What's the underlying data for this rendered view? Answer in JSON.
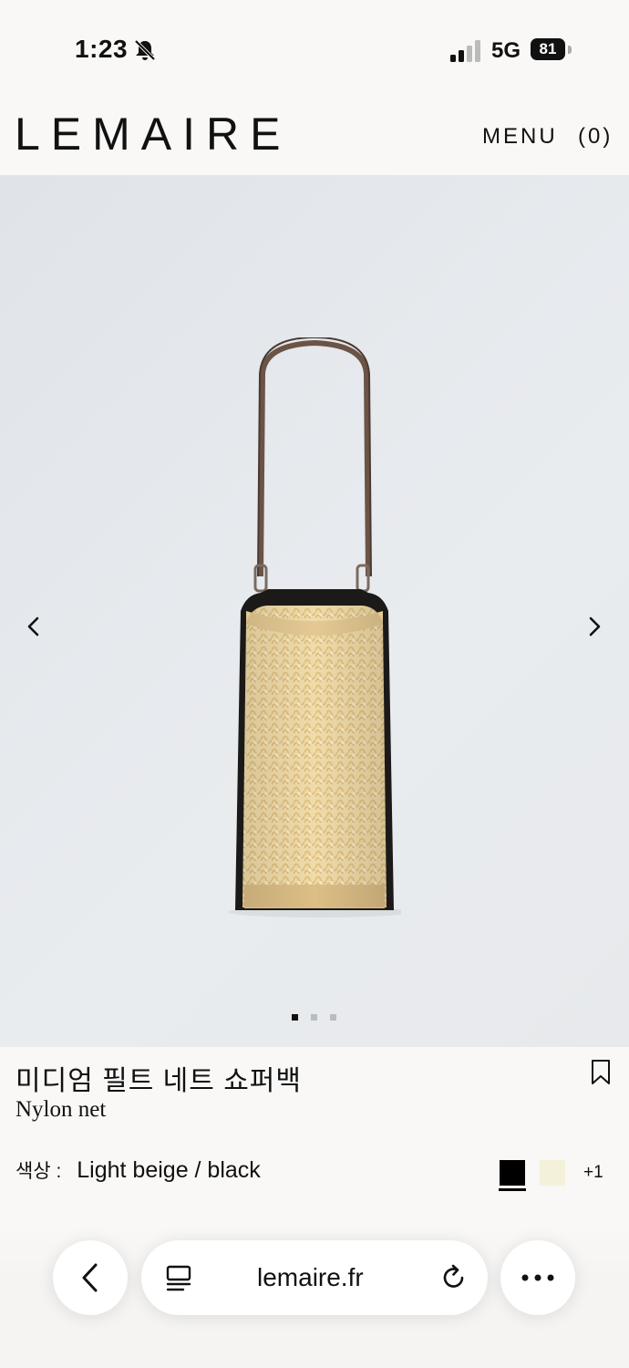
{
  "status_bar": {
    "time": "1:23",
    "network": "5G",
    "battery": "81"
  },
  "header": {
    "logo": "LEMAIRE",
    "menu_label": "MENU",
    "cart_label": "(0)"
  },
  "gallery": {
    "slide_count": 3,
    "active_slide": 1
  },
  "product": {
    "title": "미디엄 필트 네트 쇼퍼백",
    "material": "Nylon net",
    "color_label": "색상 :",
    "color_value": "Light beige / black",
    "swatches": [
      {
        "color": "#000000",
        "selected": true
      },
      {
        "color": "#f3f1d9",
        "selected": false
      }
    ],
    "more_colors": "+1"
  },
  "browser": {
    "url": "lemaire.fr"
  }
}
